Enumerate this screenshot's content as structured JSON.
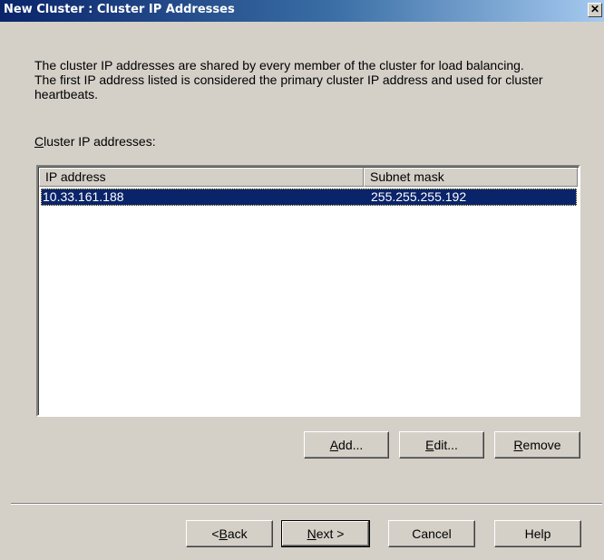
{
  "window": {
    "title": "New Cluster : Cluster IP Addresses",
    "close_glyph": "✕"
  },
  "description": {
    "line1": "The cluster IP addresses are shared by every member of the cluster for load balancing.",
    "line2": "The first IP address listed is considered the primary cluster IP address and used for cluster",
    "line3": "heartbeats."
  },
  "list": {
    "label_mnemonic": "C",
    "label_rest": "luster IP addresses:",
    "columns": [
      "IP address",
      "Subnet mask"
    ],
    "rows": [
      {
        "ip": "10.33.161.188",
        "mask": "255.255.255.192",
        "selected": true
      }
    ]
  },
  "list_buttons": {
    "add": {
      "mnemonic": "A",
      "rest": "dd..."
    },
    "edit": {
      "mnemonic": "E",
      "rest": "dit..."
    },
    "remove": {
      "mnemonic": "R",
      "rest": "emove"
    }
  },
  "footer_buttons": {
    "back": {
      "prefix": "< ",
      "mnemonic": "B",
      "rest": "ack"
    },
    "next": {
      "mnemonic": "N",
      "rest": "ext >"
    },
    "cancel": "Cancel",
    "help": "Help"
  },
  "colors": {
    "face": "#d4d0c8",
    "title_start": "#0a246a",
    "selection": "#0a246a"
  }
}
